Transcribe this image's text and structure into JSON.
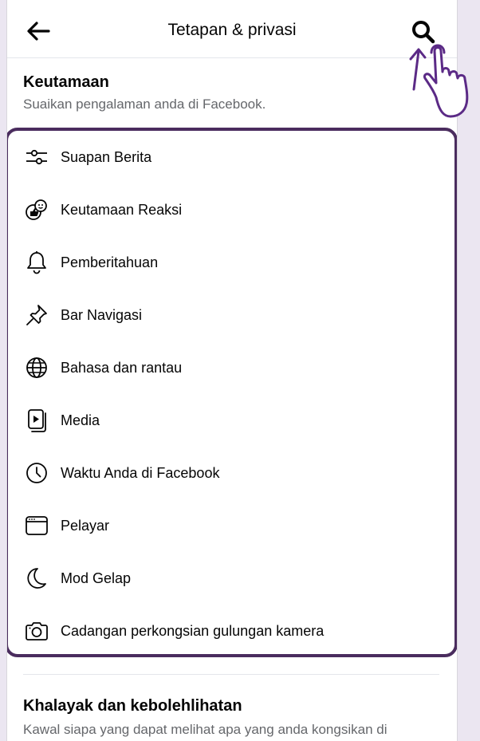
{
  "header": {
    "title": "Tetapan & privasi",
    "back_icon": "arrow-left-icon",
    "search_icon": "search-icon"
  },
  "preferences": {
    "title": "Keutamaan",
    "subtitle": "Suaikan pengalaman anda di Facebook.",
    "items": [
      {
        "label": "Suapan Berita",
        "icon": "sliders-icon"
      },
      {
        "label": "Keutamaan Reaksi",
        "icon": "reaction-icon"
      },
      {
        "label": "Pemberitahuan",
        "icon": "bell-icon"
      },
      {
        "label": "Bar Navigasi",
        "icon": "pin-icon"
      },
      {
        "label": "Bahasa dan rantau",
        "icon": "globe-icon"
      },
      {
        "label": "Media",
        "icon": "media-icon"
      },
      {
        "label": "Waktu Anda di Facebook",
        "icon": "clock-icon"
      },
      {
        "label": "Pelayar",
        "icon": "browser-icon"
      },
      {
        "label": "Mod Gelap",
        "icon": "moon-icon"
      },
      {
        "label": "Cadangan perkongsian gulungan kamera",
        "icon": "camera-icon"
      }
    ]
  },
  "audience": {
    "title": "Khalayak dan kebolehlihatan",
    "subtitle": "Kawal siapa yang dapat melihat apa yang anda kongsikan di"
  },
  "colors": {
    "highlight_border": "#4a2c5e",
    "annotation": "#5b2a86"
  }
}
